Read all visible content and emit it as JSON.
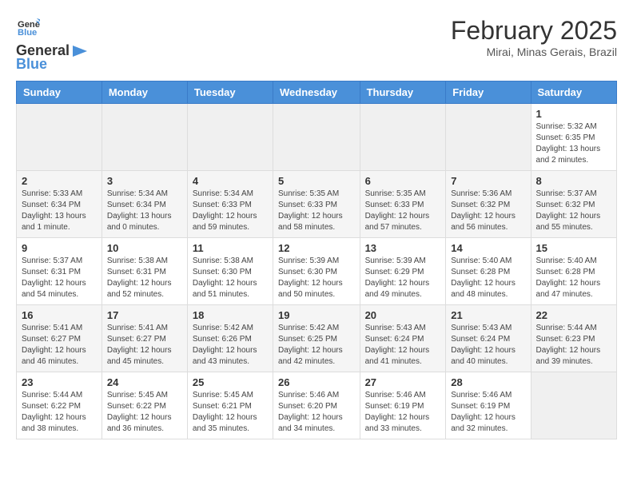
{
  "header": {
    "logo_line1": "General",
    "logo_line2": "Blue",
    "title": "February 2025",
    "subtitle": "Mirai, Minas Gerais, Brazil"
  },
  "columns": [
    "Sunday",
    "Monday",
    "Tuesday",
    "Wednesday",
    "Thursday",
    "Friday",
    "Saturday"
  ],
  "weeks": [
    [
      {
        "day": "",
        "info": ""
      },
      {
        "day": "",
        "info": ""
      },
      {
        "day": "",
        "info": ""
      },
      {
        "day": "",
        "info": ""
      },
      {
        "day": "",
        "info": ""
      },
      {
        "day": "",
        "info": ""
      },
      {
        "day": "1",
        "info": "Sunrise: 5:32 AM\nSunset: 6:35 PM\nDaylight: 13 hours and 2 minutes."
      }
    ],
    [
      {
        "day": "2",
        "info": "Sunrise: 5:33 AM\nSunset: 6:34 PM\nDaylight: 13 hours and 1 minute."
      },
      {
        "day": "3",
        "info": "Sunrise: 5:34 AM\nSunset: 6:34 PM\nDaylight: 13 hours and 0 minutes."
      },
      {
        "day": "4",
        "info": "Sunrise: 5:34 AM\nSunset: 6:33 PM\nDaylight: 12 hours and 59 minutes."
      },
      {
        "day": "5",
        "info": "Sunrise: 5:35 AM\nSunset: 6:33 PM\nDaylight: 12 hours and 58 minutes."
      },
      {
        "day": "6",
        "info": "Sunrise: 5:35 AM\nSunset: 6:33 PM\nDaylight: 12 hours and 57 minutes."
      },
      {
        "day": "7",
        "info": "Sunrise: 5:36 AM\nSunset: 6:32 PM\nDaylight: 12 hours and 56 minutes."
      },
      {
        "day": "8",
        "info": "Sunrise: 5:37 AM\nSunset: 6:32 PM\nDaylight: 12 hours and 55 minutes."
      }
    ],
    [
      {
        "day": "9",
        "info": "Sunrise: 5:37 AM\nSunset: 6:31 PM\nDaylight: 12 hours and 54 minutes."
      },
      {
        "day": "10",
        "info": "Sunrise: 5:38 AM\nSunset: 6:31 PM\nDaylight: 12 hours and 52 minutes."
      },
      {
        "day": "11",
        "info": "Sunrise: 5:38 AM\nSunset: 6:30 PM\nDaylight: 12 hours and 51 minutes."
      },
      {
        "day": "12",
        "info": "Sunrise: 5:39 AM\nSunset: 6:30 PM\nDaylight: 12 hours and 50 minutes."
      },
      {
        "day": "13",
        "info": "Sunrise: 5:39 AM\nSunset: 6:29 PM\nDaylight: 12 hours and 49 minutes."
      },
      {
        "day": "14",
        "info": "Sunrise: 5:40 AM\nSunset: 6:28 PM\nDaylight: 12 hours and 48 minutes."
      },
      {
        "day": "15",
        "info": "Sunrise: 5:40 AM\nSunset: 6:28 PM\nDaylight: 12 hours and 47 minutes."
      }
    ],
    [
      {
        "day": "16",
        "info": "Sunrise: 5:41 AM\nSunset: 6:27 PM\nDaylight: 12 hours and 46 minutes."
      },
      {
        "day": "17",
        "info": "Sunrise: 5:41 AM\nSunset: 6:27 PM\nDaylight: 12 hours and 45 minutes."
      },
      {
        "day": "18",
        "info": "Sunrise: 5:42 AM\nSunset: 6:26 PM\nDaylight: 12 hours and 43 minutes."
      },
      {
        "day": "19",
        "info": "Sunrise: 5:42 AM\nSunset: 6:25 PM\nDaylight: 12 hours and 42 minutes."
      },
      {
        "day": "20",
        "info": "Sunrise: 5:43 AM\nSunset: 6:24 PM\nDaylight: 12 hours and 41 minutes."
      },
      {
        "day": "21",
        "info": "Sunrise: 5:43 AM\nSunset: 6:24 PM\nDaylight: 12 hours and 40 minutes."
      },
      {
        "day": "22",
        "info": "Sunrise: 5:44 AM\nSunset: 6:23 PM\nDaylight: 12 hours and 39 minutes."
      }
    ],
    [
      {
        "day": "23",
        "info": "Sunrise: 5:44 AM\nSunset: 6:22 PM\nDaylight: 12 hours and 38 minutes."
      },
      {
        "day": "24",
        "info": "Sunrise: 5:45 AM\nSunset: 6:22 PM\nDaylight: 12 hours and 36 minutes."
      },
      {
        "day": "25",
        "info": "Sunrise: 5:45 AM\nSunset: 6:21 PM\nDaylight: 12 hours and 35 minutes."
      },
      {
        "day": "26",
        "info": "Sunrise: 5:46 AM\nSunset: 6:20 PM\nDaylight: 12 hours and 34 minutes."
      },
      {
        "day": "27",
        "info": "Sunrise: 5:46 AM\nSunset: 6:19 PM\nDaylight: 12 hours and 33 minutes."
      },
      {
        "day": "28",
        "info": "Sunrise: 5:46 AM\nSunset: 6:19 PM\nDaylight: 12 hours and 32 minutes."
      },
      {
        "day": "",
        "info": ""
      }
    ]
  ]
}
